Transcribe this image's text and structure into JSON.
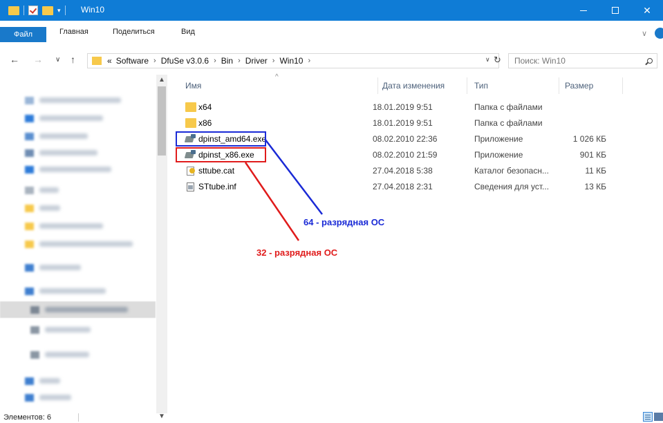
{
  "window": {
    "title": "Win10",
    "controls": {
      "minimize": "—",
      "maximize": "□",
      "close": "✕"
    }
  },
  "ribbon": {
    "tabs": [
      "Файл",
      "Главная",
      "Поделиться",
      "Вид"
    ],
    "expand": "∨"
  },
  "address": {
    "back": "←",
    "forward": "→",
    "recent": "∨",
    "up": "↑",
    "overflow": "«",
    "crumbs": [
      "Software",
      "DfuSe v3.0.6",
      "Bin",
      "Driver",
      "Win10"
    ],
    "crumb_sep": "›",
    "dropdown": "∨",
    "refresh": "↻"
  },
  "search": {
    "placeholder": "Поиск: Win10"
  },
  "columns": {
    "name": "Имя",
    "date": "Дата изменения",
    "type": "Тип",
    "size": "Размер",
    "sort_indicator": "^"
  },
  "files": [
    {
      "name": "x64",
      "date": "18.01.2019 9:51",
      "type": "Папка с файлами",
      "size": "",
      "icon": "folder-icon"
    },
    {
      "name": "x86",
      "date": "18.01.2019 9:51",
      "type": "Папка с файлами",
      "size": "",
      "icon": "folder-icon"
    },
    {
      "name": "dpinst_amd64.exe",
      "date": "08.02.2010 22:36",
      "type": "Приложение",
      "size": "1 026 КБ",
      "icon": "exe-icon"
    },
    {
      "name": "dpinst_x86.exe",
      "date": "08.02.2010 21:59",
      "type": "Приложение",
      "size": "901 КБ",
      "icon": "exe-icon"
    },
    {
      "name": "sttube.cat",
      "date": "27.04.2018 5:38",
      "type": "Каталог безопасн...",
      "size": "11 КБ",
      "icon": "catalog-icon"
    },
    {
      "name": "STtube.inf",
      "date": "27.04.2018 2:31",
      "type": "Сведения для уст...",
      "size": "13 КБ",
      "icon": "setup-info-icon"
    }
  ],
  "annotations": {
    "label_64": "64 - разрядная ОС",
    "label_32": "32 - разрядная ОС",
    "color_64": "#1a2ad6",
    "color_32": "#e01b1b"
  },
  "scrollbar": {
    "up": "▲",
    "down": "▼"
  },
  "status": {
    "items": "Элементов: 6"
  },
  "colors": {
    "titlebar": "#0f7cd6",
    "file_tab": "#1979ca",
    "folder": "#f7c94b"
  }
}
